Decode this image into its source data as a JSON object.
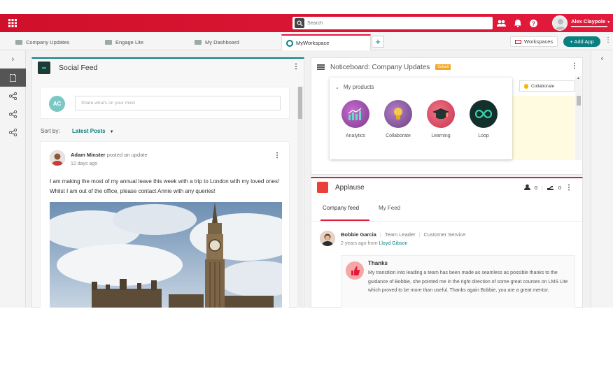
{
  "topbar": {
    "search_placeholder": "Search",
    "user_name": "Alex Claypole",
    "icons": [
      "grid-icon",
      "people-icon",
      "bell-icon",
      "help-icon"
    ],
    "accent_color": "#e21b3c"
  },
  "tabs": [
    {
      "label": "Company Updates",
      "active": false
    },
    {
      "label": "Engage Lite",
      "active": false
    },
    {
      "label": "My Dashboard",
      "active": false
    },
    {
      "label": "MyWorkspace",
      "active": true
    }
  ],
  "toolbar": {
    "workspaces_label": "Workspaces",
    "add_app_label": "+ Add App"
  },
  "social_feed": {
    "title": "Social Feed",
    "compose_initials": "AC",
    "compose_placeholder": "Share what's on your mind",
    "sort_label": "Sort by:",
    "sort_value": "Latest Posts",
    "post": {
      "author": "Adam Minster",
      "action": "posted an update",
      "time": "12 days ago",
      "text": "I am making the most of my annual leave this week with a trip to London with my loved ones! Whilst I am out of the office, please contact Annie with any queries!"
    }
  },
  "noticeboard": {
    "title": "Noticeboard: Company Updates",
    "badge": "Default",
    "collaborate_label": "Collaborate",
    "my_products": {
      "title": "My products",
      "items": [
        {
          "label": "Analytics",
          "icon": "chart-icon",
          "color": "#a64db0"
        },
        {
          "label": "Collaborate",
          "icon": "lightbulb-icon",
          "color": "#8e5ca5"
        },
        {
          "label": "Learning",
          "icon": "graduation-cap-icon",
          "color": "#e44f64"
        },
        {
          "label": "Loop",
          "icon": "infinity-icon",
          "color": "#14302d"
        }
      ]
    }
  },
  "applause": {
    "title": "Applause",
    "count_received": "0",
    "count_given": "0",
    "tabs": [
      {
        "label": "Company feed",
        "active": true
      },
      {
        "label": "My Feed",
        "active": false
      }
    ],
    "item": {
      "name": "Bobbie Garcia",
      "role": "Team Leader",
      "department": "Customer Service",
      "time": "2 years ago from",
      "from": "Lloyd Gibson",
      "message_title": "Thanks",
      "message": "My transition into leading a team has been made as seamless as possible thanks to the guidance of Bobbie, she pointed me in the right direction of some great courses on LMS Lite which proved to be more than useful. Thanks again Bobbie, you are a great mentor."
    }
  }
}
